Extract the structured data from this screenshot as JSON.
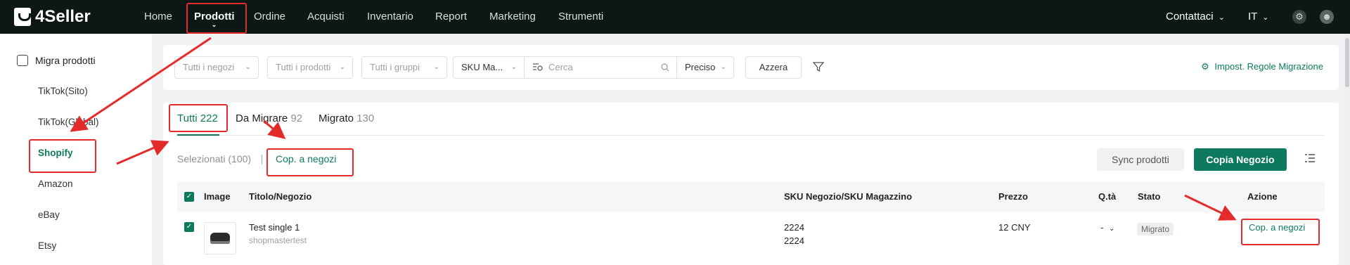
{
  "brand": {
    "name": "4Seller"
  },
  "topnav": {
    "items": [
      "Home",
      "Prodotti",
      "Ordine",
      "Acquisti",
      "Inventario",
      "Report",
      "Marketing",
      "Strumenti"
    ],
    "active": "Prodotti",
    "contact": "Contattaci",
    "language": "IT"
  },
  "sidebar": {
    "heading": "Migra prodotti",
    "items": [
      "TikTok(Sito)",
      "TikTok(Global)",
      "Shopify",
      "Amazon",
      "eBay",
      "Etsy"
    ],
    "active": "Shopify"
  },
  "filters": {
    "store_placeholder": "Tutti i negozi",
    "product_placeholder": "Tutti i prodotti",
    "group_placeholder": "Tutti i gruppi",
    "sku_type": "SKU Ma...",
    "search_placeholder": "Cerca",
    "match_mode": "Preciso",
    "reset_label": "Azzera",
    "rules_link": "Impost. Regole Migrazione"
  },
  "tabs": [
    {
      "label": "Tutti",
      "count": "222"
    },
    {
      "label": "Da Migrare",
      "count": "92"
    },
    {
      "label": "Migrato",
      "count": "130"
    }
  ],
  "toolbar": {
    "selected_text": "Selezionati (100)",
    "copy_link": "Cop. a negozi",
    "sync_button": "Sync prodotti",
    "copy_button": "Copia Negozio"
  },
  "table": {
    "headers": {
      "image": "Image",
      "title": "Titolo/Negozio",
      "sku": "SKU Negozio/SKU Magazzino",
      "price": "Prezzo",
      "qty": "Q.tà",
      "status": "Stato",
      "action": "Azione"
    },
    "rows": [
      {
        "title": "Test single 1",
        "store": "shopmastertest",
        "sku_store": "2224",
        "sku_warehouse": "2224",
        "price": "12 CNY",
        "qty": "-",
        "status": "Migrato",
        "action": "Cop. a negozi"
      }
    ]
  },
  "colors": {
    "accent": "#0e7a5d",
    "nav_bg": "#0c1815",
    "annotation": "#e52a2a"
  }
}
